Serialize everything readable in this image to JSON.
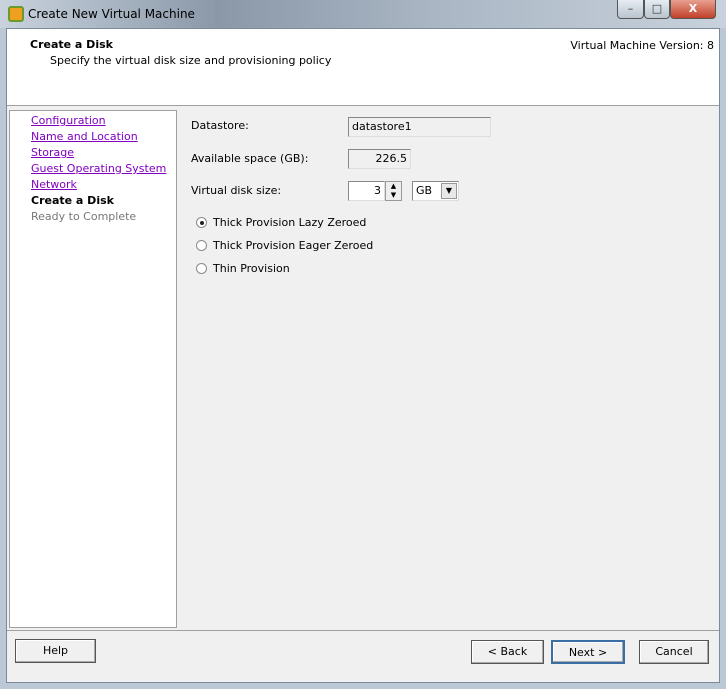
{
  "window": {
    "title": "Create New Virtual Machine",
    "minimize": "–",
    "maximize": "□",
    "close": "X"
  },
  "header": {
    "title": "Create a Disk",
    "subtitle": "Specify the virtual disk size and provisioning policy",
    "version": "Virtual Machine Version: 8"
  },
  "nav": {
    "items": [
      {
        "label": "Configuration",
        "state": "link"
      },
      {
        "label": "Name and Location",
        "state": "link"
      },
      {
        "label": "Storage",
        "state": "link"
      },
      {
        "label": "Guest Operating System",
        "state": "link"
      },
      {
        "label": "Network",
        "state": "link"
      },
      {
        "label": "Create a Disk",
        "state": "current"
      },
      {
        "label": "Ready to Complete",
        "state": "disabled"
      }
    ]
  },
  "form": {
    "datastore_label": "Datastore:",
    "datastore_value": "datastore1",
    "available_label": "Available space (GB):",
    "available_value": "226.5",
    "size_label": "Virtual disk size:",
    "size_value": "3",
    "unit_value": "GB",
    "provisioning": [
      {
        "label": "Thick Provision Lazy Zeroed",
        "selected": true
      },
      {
        "label": "Thick Provision Eager Zeroed",
        "selected": false
      },
      {
        "label": "Thin Provision",
        "selected": false
      }
    ]
  },
  "footer": {
    "help": "Help",
    "back": "< Back",
    "next": "Next >",
    "cancel": "Cancel"
  }
}
